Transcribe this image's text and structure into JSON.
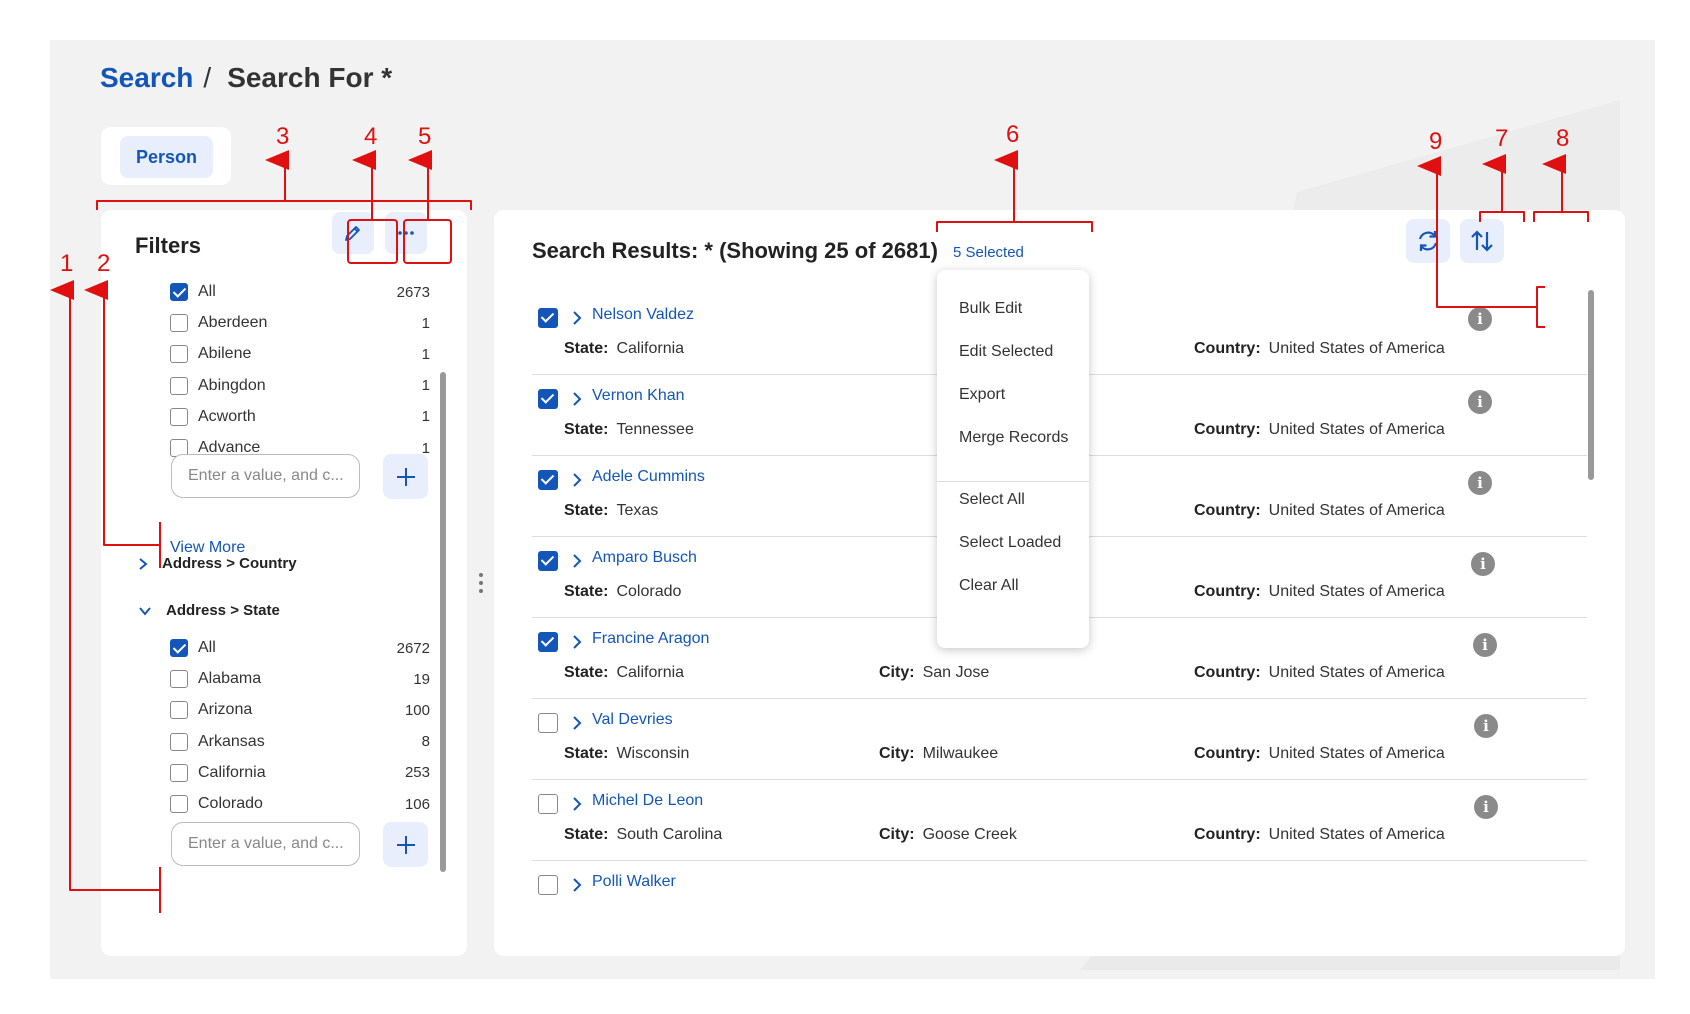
{
  "breadcrumb": {
    "link": "Search",
    "separator": "/",
    "current": "Search For *"
  },
  "tabs": [
    {
      "label": "Person",
      "active": true
    }
  ],
  "filters": {
    "title": "Filters",
    "city_options": [
      {
        "label": "All",
        "count": "2673",
        "checked": true
      },
      {
        "label": "Aberdeen",
        "count": "1",
        "checked": false
      },
      {
        "label": "Abilene",
        "count": "1",
        "checked": false
      },
      {
        "label": "Abingdon",
        "count": "1",
        "checked": false
      },
      {
        "label": "Acworth",
        "count": "1",
        "checked": false
      },
      {
        "label": "Advance",
        "count": "1",
        "checked": false
      }
    ],
    "input_placeholder": "Enter a value, and c...",
    "view_more": "View More",
    "sections": [
      {
        "label": "Address > Country",
        "expanded": false
      },
      {
        "label": "Address > State",
        "expanded": true
      }
    ],
    "state_options": [
      {
        "label": "All",
        "count": "2672",
        "checked": true
      },
      {
        "label": "Alabama",
        "count": "19",
        "checked": false
      },
      {
        "label": "Arizona",
        "count": "100",
        "checked": false
      },
      {
        "label": "Arkansas",
        "count": "8",
        "checked": false
      },
      {
        "label": "California",
        "count": "253",
        "checked": false
      },
      {
        "label": "Colorado",
        "count": "106",
        "checked": false
      }
    ]
  },
  "results": {
    "title": "Search Results: * (Showing 25 of 2681)",
    "selected_label": "5 Selected",
    "field_labels": {
      "state": "State:",
      "city": "City:",
      "country": "Country:"
    },
    "rows": [
      {
        "name": "Nelson Valdez",
        "state": "California",
        "city": "",
        "country": "United States of America",
        "checked": true
      },
      {
        "name": "Vernon Khan",
        "state": "Tennessee",
        "city": "",
        "country": "United States of America",
        "checked": true
      },
      {
        "name": "Adele Cummins",
        "state": "Texas",
        "city": "",
        "country": "United States of America",
        "checked": true
      },
      {
        "name": "Amparo Busch",
        "state": "Colorado",
        "city": "",
        "country": "United States of America",
        "checked": true
      },
      {
        "name": "Francine Aragon",
        "state": "California",
        "city": "San Jose",
        "country": "United States of America",
        "checked": true
      },
      {
        "name": "Val Devries",
        "state": "Wisconsin",
        "city": "Milwaukee",
        "country": "United States of America",
        "checked": false
      },
      {
        "name": "Michel De Leon",
        "state": "South Carolina",
        "city": "Goose Creek",
        "country": "United States of America",
        "checked": false
      },
      {
        "name": "Polli Walker",
        "state": "",
        "city": "",
        "country": "",
        "checked": false
      }
    ]
  },
  "selection_menu": {
    "items": [
      "Bulk Edit",
      "Edit Selected",
      "Export",
      "Merge Records",
      "Select All",
      "Select Loaded",
      "Clear All"
    ]
  },
  "annotations": [
    "1",
    "2",
    "3",
    "4",
    "5",
    "6",
    "7",
    "8",
    "9"
  ],
  "colors": {
    "accent": "#1456b8",
    "annotation": "#e01010",
    "chip_bg": "#e8eefb"
  }
}
